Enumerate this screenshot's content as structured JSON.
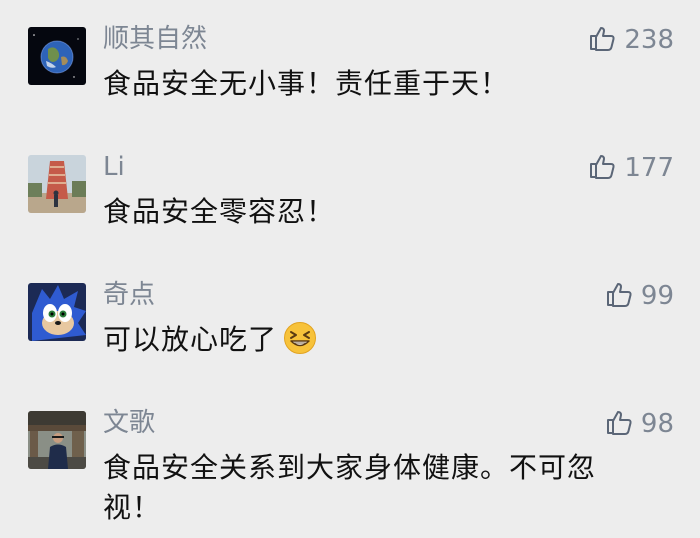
{
  "comments": [
    {
      "user": "顺其自然",
      "text": "食品安全无小事！责任重于天！",
      "likes": "238",
      "avatar_icon": "earth-avatar"
    },
    {
      "user": "Li",
      "text": "食品安全零容忍！",
      "likes": "177",
      "avatar_icon": "monument-photo-avatar"
    },
    {
      "user": "奇点",
      "text": "可以放心吃了",
      "likes": "99",
      "avatar_icon": "sonic-avatar",
      "emoji": "grinning-squint-emoji"
    },
    {
      "user": "文歌",
      "text": "食品安全关系到大家身体健康。不可忽视！",
      "likes": "98",
      "avatar_icon": "person-photo-avatar"
    }
  ],
  "like_icon": "thumbs-up-icon",
  "colors": {
    "background": "#ededed",
    "username": "#7d8693",
    "comment_text": "#111111",
    "like": "#7d8693"
  }
}
